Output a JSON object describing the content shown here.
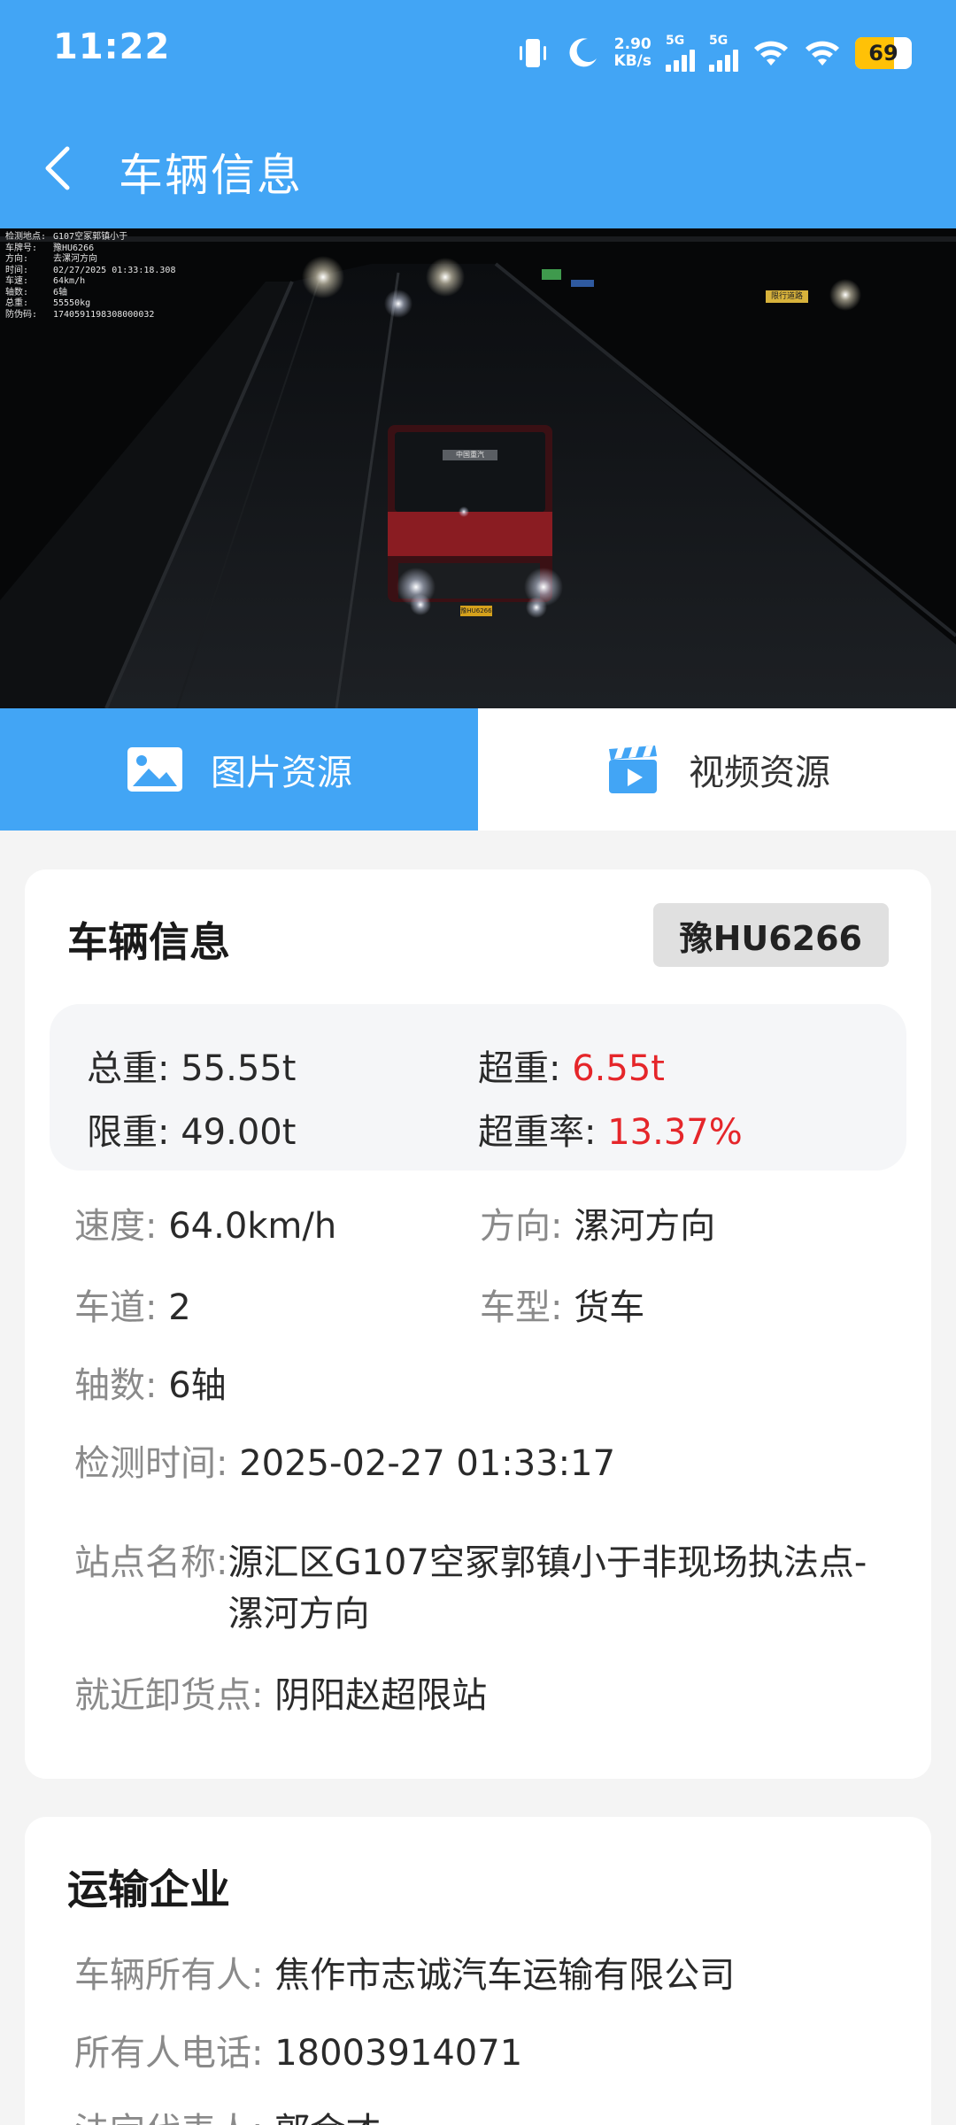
{
  "status_bar": {
    "time": "11:22",
    "net_speed_value": "2.90",
    "net_speed_unit": "KB/s",
    "sim1_label": "5G",
    "sim2_label": "5G",
    "battery": "69",
    "icons": [
      "vibrate-icon",
      "moon-icon",
      "signal-icon",
      "signal-icon",
      "wifi-icon",
      "wifi-icon",
      "battery-icon"
    ]
  },
  "header": {
    "title": "车辆信息",
    "back_icon": "chevron-left-icon"
  },
  "camera_overlay": [
    {
      "k": "检测地点:",
      "v": "G107空冢郭镇小于"
    },
    {
      "k": "车牌号:",
      "v": "豫HU6266"
    },
    {
      "k": "方向:",
      "v": "去漯河方向"
    },
    {
      "k": "时间:",
      "v": "02/27/2025 01:33:18.308"
    },
    {
      "k": "车速:",
      "v": "64km/h"
    },
    {
      "k": "轴数:",
      "v": "6轴"
    },
    {
      "k": "总重:",
      "v": "55550kg"
    },
    {
      "k": "防伪码:",
      "v": "1740591198308000032"
    }
  ],
  "camera_scene": {
    "plate_text": "豫HU6266",
    "sign_text": "限行道路",
    "truck_banner": "中国重汽"
  },
  "tabs": [
    {
      "label": "图片资源",
      "icon": "image-icon",
      "active": true
    },
    {
      "label": "视频资源",
      "icon": "video-clapper-icon",
      "active": false
    }
  ],
  "vehicle_card": {
    "title": "车辆信息",
    "plate": "豫HU6266",
    "gross_label": "总重: ",
    "gross_value": "55.55t",
    "over_label": "超重: ",
    "over_value": "6.55t",
    "limit_label": "限重: ",
    "limit_value": "49.00t",
    "over_rate_label": "超重率: ",
    "over_rate_value": "13.37%",
    "speed_label": "速度: ",
    "speed_value": "64.0km/h",
    "direction_label": "方向: ",
    "direction_value": "漯河方向",
    "lane_label": "车道: ",
    "lane_value": "2",
    "type_label": "车型: ",
    "type_value": "货车",
    "axles_label": "轴数: ",
    "axles_value": "6轴",
    "time_label": "检测时间: ",
    "time_value": "2025-02-27 01:33:17",
    "station_label": "站点名称: ",
    "station_value": "源汇区G107空冢郭镇小于非现场执法点-漯河方向",
    "unload_label": "就近卸货点: ",
    "unload_value": "阴阳赵超限站",
    "colors": {
      "accent": "#42a5f5",
      "alert": "#e5262a"
    }
  },
  "company_card": {
    "title": "运输企业",
    "owner_label": "车辆所有人: ",
    "owner_value": "焦作市志诚汽车运输有限公司",
    "phone_label": "所有人电话: ",
    "phone_value": "18003914071",
    "legal_label": "法定代表人: ",
    "legal_value": "郭金才"
  }
}
